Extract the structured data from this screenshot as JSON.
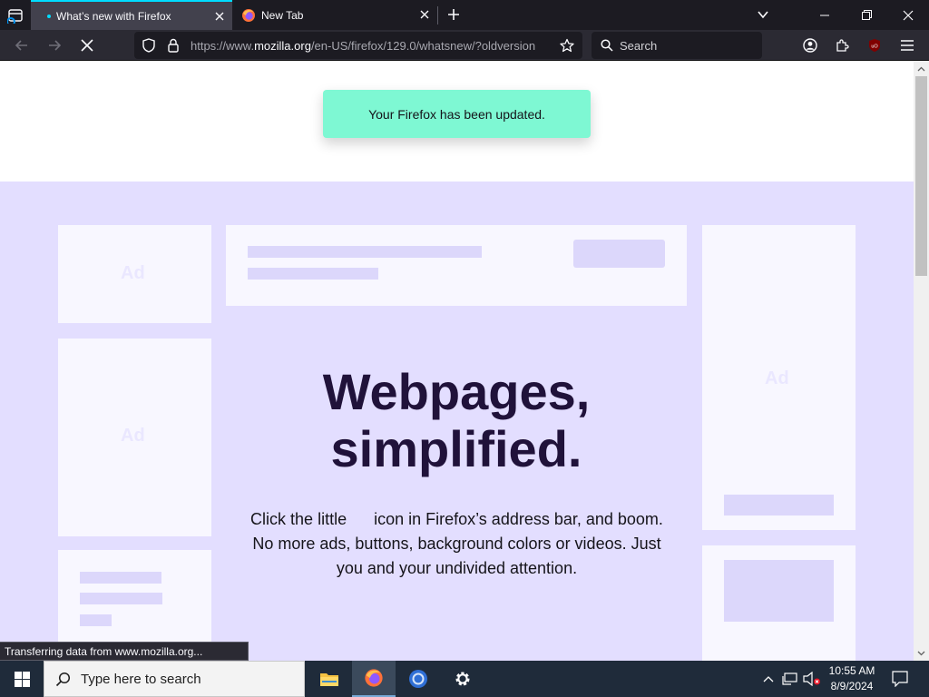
{
  "tabs": [
    {
      "title": "What’s new with Firefox",
      "active": true
    },
    {
      "title": "New Tab",
      "active": false
    }
  ],
  "navbar": {
    "url_prefix": "https://www.",
    "url_domain": "mozilla.org",
    "url_path": "/en-US/firefox/129.0/whatsnew/?oldversion",
    "search_placeholder": "Search"
  },
  "page": {
    "notification": "Your Firefox has been updated.",
    "ad_label": "Ad",
    "headline_line1": "Webpages,",
    "headline_line2": "simplified.",
    "body": "Click the little      icon in Firefox’s address bar, and boom. No more ads, buttons, background colors or videos. Just you and your undivided attention."
  },
  "status_text": "Transferring data from www.mozilla.org...",
  "taskbar": {
    "search_placeholder": "Type here to search",
    "time": "10:55 AM",
    "date": "8/9/2024"
  },
  "colors": {
    "tab_accent": "#00ddff",
    "notification_bg": "#7ef8d3",
    "hero_bg": "#e3deff",
    "headline": "#20123a"
  }
}
